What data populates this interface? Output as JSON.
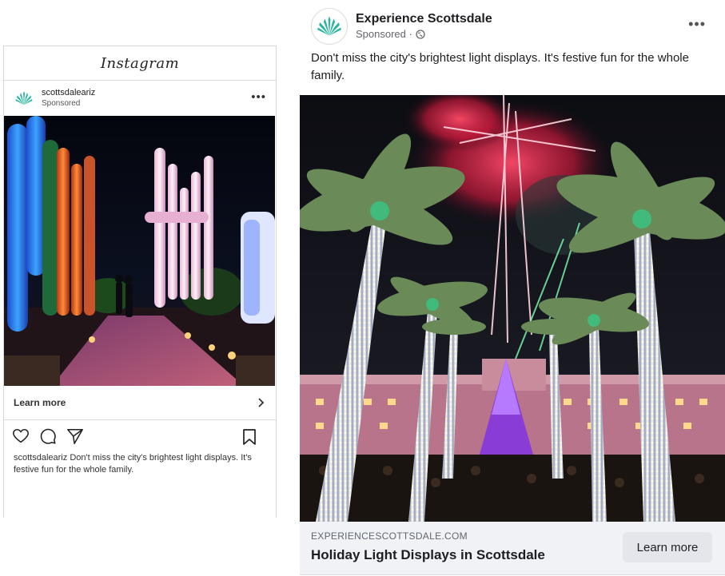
{
  "instagram": {
    "logo_text": "Instagram",
    "username": "scottsdaleariz",
    "sponsored": "Sponsored",
    "more": "•••",
    "cta": "Learn more",
    "caption_user": "scottsdaleariz",
    "caption_text": " Don't miss the city's brightest light displays. It's festive fun for the whole family."
  },
  "facebook": {
    "page_name": "Experience Scottsdale",
    "sponsored": "Sponsored ·",
    "more": "•••",
    "post_text": "Don't miss the city's brightest light displays. It's festive fun for the whole family.",
    "link_domain": "EXPERIENCESCOTTSDALE.COM",
    "link_headline": "Holiday Light Displays in Scottsdale",
    "cta": "Learn more"
  },
  "colors": {
    "brand_green": "#2bb5a0",
    "fb_footer_bg": "#f0f2f5",
    "fb_button_bg": "#e4e6eb"
  },
  "icons": [
    "agave-logo-icon",
    "more-dots-icon",
    "chevron-right-icon",
    "heart-icon",
    "comment-icon",
    "share-icon",
    "bookmark-icon",
    "globe-icon"
  ]
}
